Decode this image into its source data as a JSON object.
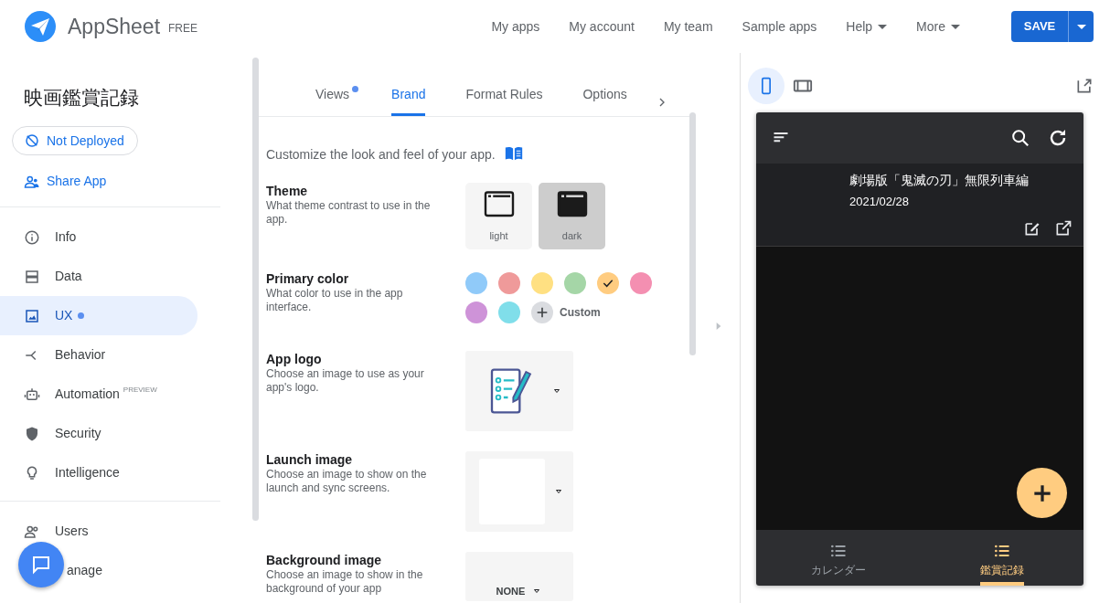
{
  "header": {
    "brand": "AppSheet",
    "plan": "FREE",
    "save_button": "SAVE",
    "nav": [
      {
        "label": "My apps",
        "dropdown": false
      },
      {
        "label": "My account",
        "dropdown": false
      },
      {
        "label": "My team",
        "dropdown": false
      },
      {
        "label": "Sample apps",
        "dropdown": false
      },
      {
        "label": "Help",
        "dropdown": true
      },
      {
        "label": "More",
        "dropdown": true
      }
    ]
  },
  "sidebar": {
    "app_name": "映画鑑賞記録",
    "deploy_status": "Not Deployed",
    "share": "Share App",
    "items": [
      {
        "label": "Info",
        "selected": false,
        "dot": false
      },
      {
        "label": "Data",
        "selected": false,
        "dot": false
      },
      {
        "label": "UX",
        "selected": true,
        "dot": true
      },
      {
        "label": "Behavior",
        "selected": false,
        "dot": false
      },
      {
        "label": "Automation",
        "badge": "PREVIEW",
        "selected": false,
        "dot": false
      },
      {
        "label": "Security",
        "selected": false,
        "dot": false
      },
      {
        "label": "Intelligence",
        "selected": false,
        "dot": false
      }
    ],
    "items_2": [
      {
        "label": "Users",
        "selected": false,
        "dot": false
      },
      {
        "label": "anage",
        "selected": false,
        "dot": false
      }
    ]
  },
  "tabs": [
    {
      "label": "Views",
      "dot": true,
      "selected": false
    },
    {
      "label": "Brand",
      "dot": false,
      "selected": true
    },
    {
      "label": "Format Rules",
      "dot": false,
      "selected": false
    },
    {
      "label": "Options",
      "dot": false,
      "selected": false
    }
  ],
  "intro": "Customize the look and feel of your app.",
  "settings": [
    {
      "kind": "theme",
      "title": "Theme",
      "description": "What theme contrast to use in the app.",
      "options": [
        {
          "label": "light",
          "selected": false
        },
        {
          "label": "dark",
          "selected": true
        }
      ]
    },
    {
      "kind": "colors",
      "title": "Primary color",
      "description": "What color to use in the app interface.",
      "custom_label": "Custom",
      "colors": [
        {
          "color": "#90caf9",
          "selected": false
        },
        {
          "color": "#ef9a9a",
          "selected": false
        },
        {
          "color": "#ffe082",
          "selected": false
        },
        {
          "color": "#a5d6a7",
          "selected": false
        },
        {
          "color": "#ffcc80",
          "selected": true
        },
        {
          "color": "#f48fb1",
          "selected": false
        },
        {
          "color": "#ce93d8",
          "selected": false
        },
        {
          "color": "#80deea",
          "selected": false
        }
      ]
    },
    {
      "kind": "logo",
      "title": "App logo",
      "description": "Choose an image to use as your app's logo."
    },
    {
      "kind": "blank",
      "title": "Launch image",
      "description": "Choose an image to show on the launch and sync screens."
    },
    {
      "kind": "none",
      "title": "Background image",
      "description": "Choose an image to show in the background of your app",
      "value": "NONE"
    }
  ],
  "preview": {
    "device_toggles": [
      {
        "selected": true
      },
      {
        "selected": false
      }
    ],
    "record": {
      "title": "劇場版「鬼滅の刃」無限列車編",
      "date": "2021/02/28"
    },
    "bottom_nav": [
      {
        "label": "カレンダー",
        "selected": false
      },
      {
        "label": "鑑賞記録",
        "selected": true
      }
    ]
  }
}
